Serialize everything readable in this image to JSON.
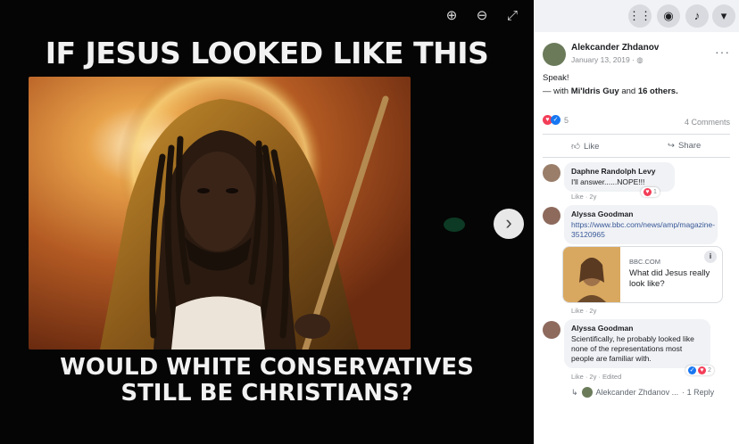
{
  "meme": {
    "top_text": "IF JESUS LOOKED LIKE THIS",
    "bottom_line1": "WOULD WHITE CONSERVATIVES",
    "bottom_line2": "STILL BE CHRISTIANS?"
  },
  "viewer_toolbar": {
    "zoom_in_icon": "zoom-in-icon",
    "zoom_out_icon": "zoom-out-icon",
    "fullscreen_icon": "fullscreen-icon",
    "next_icon": "chevron-right-icon"
  },
  "topbar": {
    "icons": [
      "grid-menu-icon",
      "messenger-icon",
      "bell-icon",
      "account-caret-icon"
    ]
  },
  "post": {
    "author": "Alekcander Zhdanov",
    "date": "January 13, 2019 · ",
    "text": "Speak!",
    "tagged_prefix": "— with ",
    "tagged_name": "Mi'Idris Guy",
    "tagged_mid": " and ",
    "tagged_others": "16 others.",
    "reaction_count": "5",
    "comment_count": "4 Comments",
    "like_label": "Like",
    "share_label": "Share",
    "colors": {
      "like": "#1877f2",
      "love": "#f33e58",
      "link": "#385898"
    }
  },
  "comments": [
    {
      "author": "Daphne Randolph Levy",
      "text": "I'll answer......NOPE!!!",
      "meta": "Like · 2y",
      "react": "1"
    },
    {
      "author": "Alyssa Goodman",
      "link": "https://www.bbc.com/news/amp/magazine-35120965",
      "meta": "Like · 2y",
      "card_domain": "BBC.COM",
      "card_title": "What did Jesus really look like?"
    },
    {
      "author": "Alyssa Goodman",
      "text": "Scientifically, he probably looked like none of the representations most people are familiar with.",
      "meta": "Like · 2y · Edited",
      "react": "2"
    }
  ],
  "reply": {
    "text": "Alekcander Zhdanov ...",
    "count": "· 1 Reply"
  }
}
